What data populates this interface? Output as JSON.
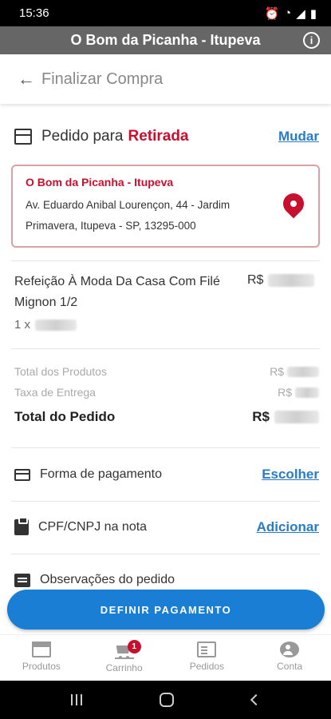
{
  "status_bar": {
    "time": "15:36",
    "icons": [
      "alarm-icon",
      "wifi-icon",
      "signal-icon",
      "signal-icon",
      "battery-icon"
    ]
  },
  "app_bar": {
    "title": "O Bom da Picanha - Itupeva",
    "info_glyph": "i"
  },
  "page_header": {
    "back_glyph": "←",
    "title": "Finalizar Compra"
  },
  "order": {
    "label": "Pedido para",
    "type": "Retirada",
    "change_link": "Mudar"
  },
  "store": {
    "name": "O Bom da Picanha - Itupeva",
    "address": "Av. Eduardo Anibal Lourençon, 44 - Jardim Primavera, Itupeva - SP, 13295-000"
  },
  "item": {
    "name": "Refeição À Moda Da Casa Com Filé Mignon 1/2",
    "currency": "R$",
    "qty_prefix": "1 x"
  },
  "totals": {
    "products_label": "Total dos Produtos",
    "delivery_label": "Taxa de Entrega",
    "order_label": "Total do Pedido",
    "currency": "R$"
  },
  "options": {
    "payment_label": "Forma de pagamento",
    "payment_link": "Escolher",
    "cpf_label": "CPF/CNPJ na nota",
    "cpf_link": "Adicionar",
    "notes_label": "Observações do pedido"
  },
  "cta": {
    "label": "DEFINIR PAGAMENTO"
  },
  "bottom_nav": {
    "items": [
      {
        "label": "Produtos",
        "icon": "store-icon"
      },
      {
        "label": "Carrinho",
        "icon": "cart-icon",
        "badge": "1"
      },
      {
        "label": "Pedidos",
        "icon": "list-icon"
      },
      {
        "label": "Conta",
        "icon": "user-icon"
      }
    ]
  },
  "colors": {
    "accent": "#1a7fd4",
    "brand_red": "#c8102e",
    "app_bar": "#666666"
  }
}
